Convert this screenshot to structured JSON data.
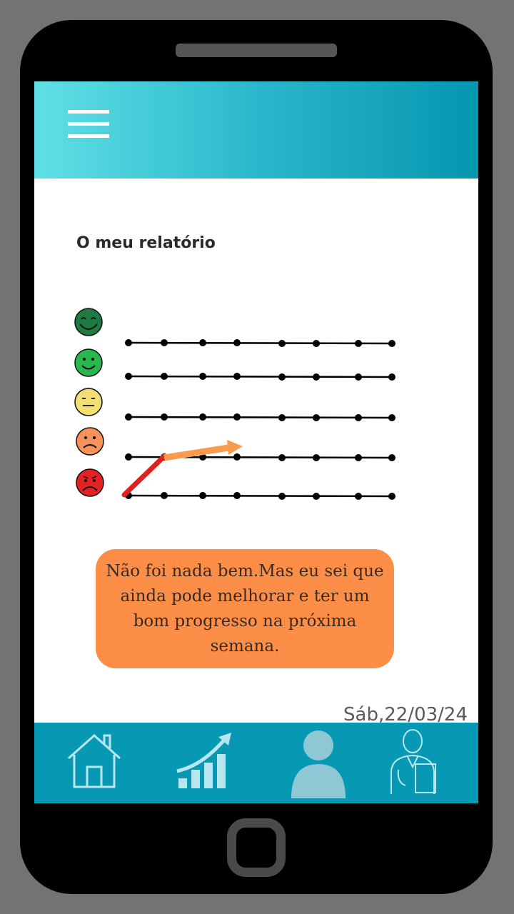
{
  "header": {
    "menu_icon": "hamburger-menu-icon"
  },
  "report": {
    "title": "O meu relatório"
  },
  "mood_chart": {
    "levels": [
      {
        "mood": "very-happy",
        "icon": "very-happy-face-icon",
        "color": "#1d7a42"
      },
      {
        "mood": "happy",
        "icon": "happy-face-icon",
        "color": "#28b84e"
      },
      {
        "mood": "neutral",
        "icon": "neutral-face-icon",
        "color": "#f3de72"
      },
      {
        "mood": "sad",
        "icon": "sad-face-icon",
        "color": "#f7935a"
      },
      {
        "mood": "very-sad",
        "icon": "very-sad-face-icon",
        "color": "#e42224"
      }
    ],
    "points_per_line": 8,
    "trend": {
      "from": "very-sad",
      "to": "sad",
      "colors": [
        "#e01f1f",
        "#f99b4e"
      ]
    }
  },
  "message": {
    "text": "Não foi nada bem.Mas eu sei que ainda pode melhorar e ter um bom progresso na próxima semana.",
    "background": "#fd8e48"
  },
  "date": "Sáb,22/03/24",
  "bottom_nav": {
    "background": "#0799b4",
    "items": [
      {
        "name": "home",
        "icon": "house-icon"
      },
      {
        "name": "progress",
        "icon": "growth-chart-icon"
      },
      {
        "name": "profile",
        "icon": "user-icon"
      },
      {
        "name": "doctor",
        "icon": "doctor-icon"
      }
    ]
  }
}
